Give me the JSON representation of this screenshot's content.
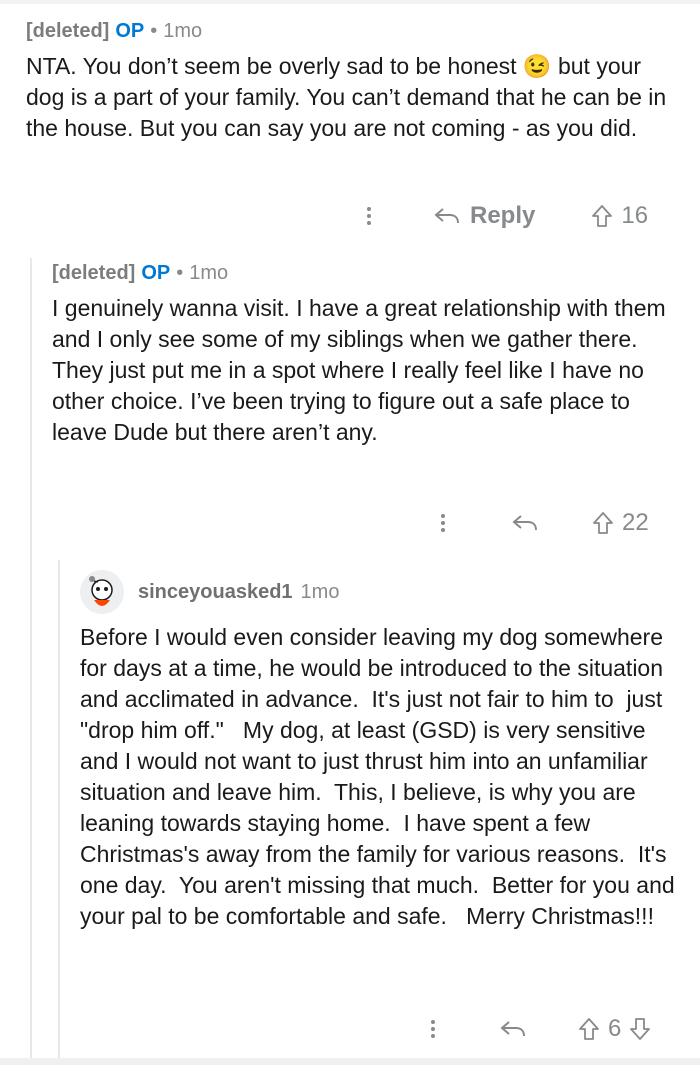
{
  "comments": [
    {
      "author": "[deleted]",
      "op_badge": "OP",
      "separator": "•",
      "time": "1mo",
      "body": "NTA. You don’t seem be overly sad to be honest 😉 but your dog is a part of your family. You can’t demand that he can be in the house. But you can say you are not coming - as you did.",
      "reply_label": "Reply",
      "score": "16"
    },
    {
      "author": "[deleted]",
      "op_badge": "OP",
      "separator": "•",
      "time": "1mo",
      "body": "I genuinely wanna visit. I have a great relationship with them and I only see some of my siblings when we gather there. They just put me in a spot where I really feel like I have no other choice. I’ve been trying to figure out a safe place to leave Dude but there aren’t any.",
      "score": "22"
    },
    {
      "author": "sinceyouasked1",
      "time": "1mo",
      "body": "Before I would even consider leaving my dog somewhere for days at a time, he would be introduced to the situation and acclimated in advance.  It's just not fair to him to  just \"drop him off.\"   My dog, at least (GSD) is very sensitive and I would not want to just thrust him into an unfamiliar situation and leave him.  This, I believe, is why you are leaning towards staying home.  I have spent a few Christmas's away from the family for various reasons.  It's one day.  You aren't missing that much.  Better for you and your pal to be comfortable and safe.   Merry Christmas!!!",
      "score": "6"
    }
  ],
  "icons": {
    "more": "more-vertical-icon",
    "reply": "reply-arrow-icon",
    "upvote": "upvote-arrow-icon",
    "downvote": "downvote-arrow-icon"
  },
  "colors": {
    "op": "#0079d3",
    "meta": "#878a8c",
    "text": "#1a1a1b"
  }
}
